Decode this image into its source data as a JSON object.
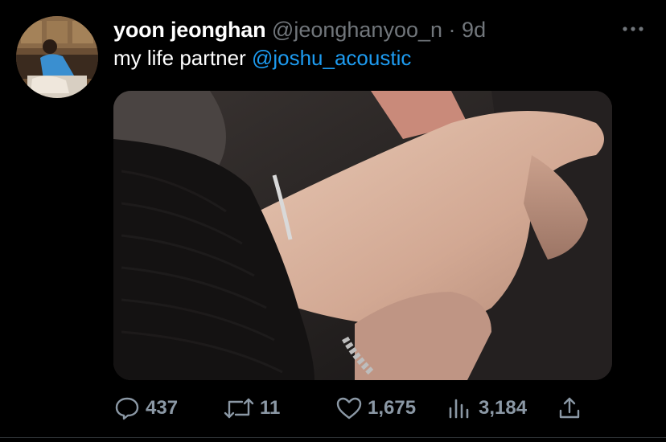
{
  "tweet": {
    "display_name": "yoon jeonghan",
    "handle": "@jeonghanyoo_n",
    "separator": "·",
    "time": "9d",
    "text_prefix": "my life partner ",
    "mention": "@joshu_acoustic"
  },
  "actions": {
    "replies": "437",
    "retweets": "11",
    "likes": "1,675",
    "views": "3,184"
  },
  "icons": {
    "more": "more-options-icon",
    "reply": "reply-icon",
    "retweet": "retweet-icon",
    "like": "like-icon",
    "views": "views-icon",
    "share": "share-icon"
  },
  "colors": {
    "background": "#000000",
    "primary_text": "#ffffff",
    "secondary_text": "#71767b",
    "accent": "#1d9bf0",
    "action_text": "#8b98a5"
  }
}
